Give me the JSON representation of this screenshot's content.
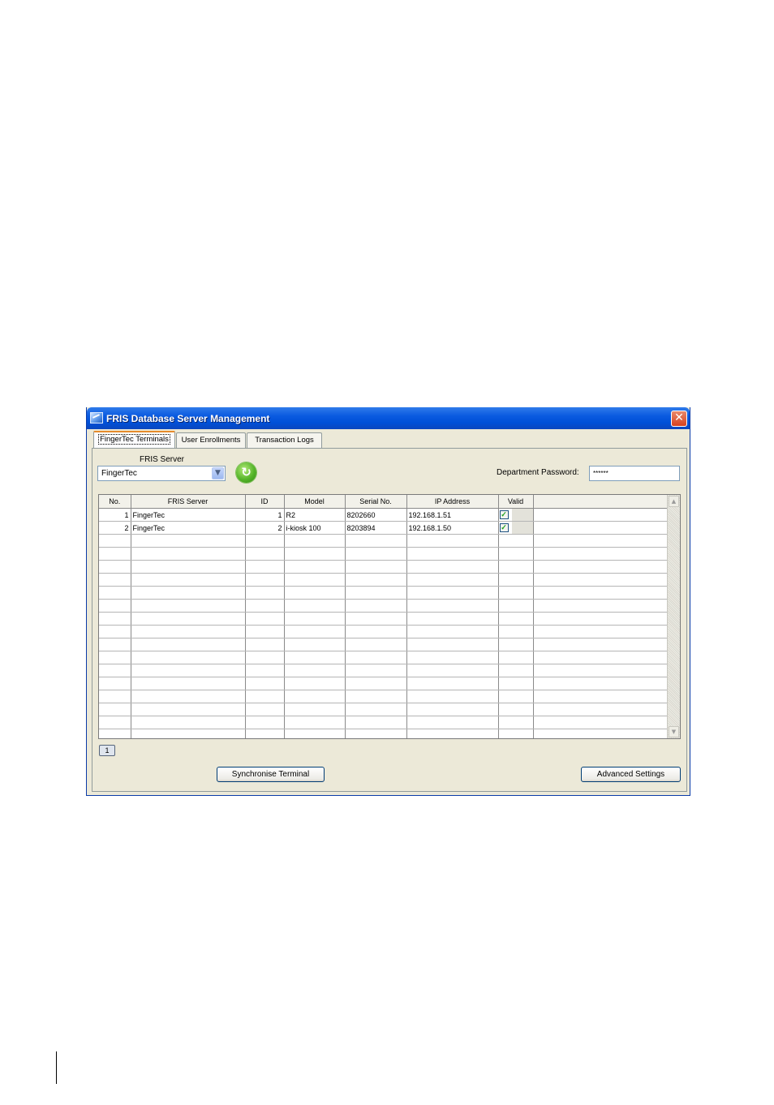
{
  "window": {
    "title": "FRIS Database Server Management",
    "close_glyph": "✕"
  },
  "tabs": [
    {
      "label": "FingerTec Terminals",
      "active": true
    },
    {
      "label": "User Enrollments",
      "active": false
    },
    {
      "label": "Transaction Logs",
      "active": false
    }
  ],
  "server": {
    "label": "FRIS Server",
    "value": "FingerTec"
  },
  "password": {
    "label": "Department Password:",
    "value": "******"
  },
  "grid": {
    "columns": [
      "No.",
      "FRIS Server",
      "ID",
      "Model",
      "Serial No.",
      "IP Address",
      "Valid"
    ],
    "rows": [
      {
        "no": "1",
        "server": "FingerTec",
        "id": "1",
        "model": "R2",
        "serial": "8202660",
        "ip": "192.168.1.51",
        "valid": true
      },
      {
        "no": "2",
        "server": "FingerTec",
        "id": "2",
        "model": "i-kiosk 100",
        "serial": "8203894",
        "ip": "192.168.1.50",
        "valid": true
      }
    ],
    "empty_rows": 16
  },
  "pagination": {
    "current": "1"
  },
  "buttons": {
    "sync": "Synchronise Terminal",
    "advanced": "Advanced Settings"
  },
  "colors": {
    "titlebar": "#0050d8",
    "window_bg": "#ece9d8",
    "active_tab_accent": "#e68b2c",
    "check": "#21a121"
  },
  "icons": {
    "app": "app-icon",
    "refresh": "refresh-icon",
    "dropdown": "chevron-down-icon",
    "close": "close-icon"
  }
}
